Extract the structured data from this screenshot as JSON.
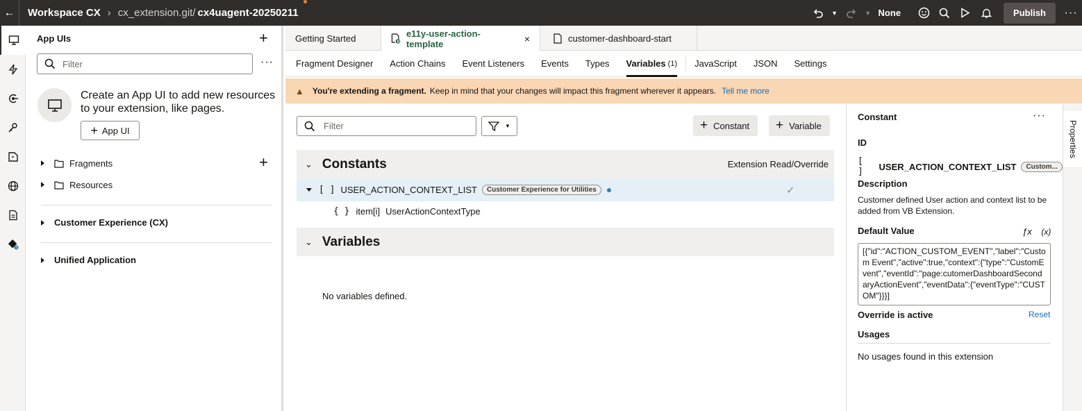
{
  "topbar": {
    "workspace": "Workspace CX",
    "repo": "cx_extension.git/",
    "branch": "cx4uagent-20250211",
    "level": "None",
    "publish_label": "Publish"
  },
  "panel": {
    "title": "App UIs",
    "filter_placeholder": "Filter",
    "create_text": "Create an App UI to add new resources to your extension, like pages.",
    "create_button": "App UI",
    "tree": [
      "Fragments",
      "Resources"
    ],
    "sections": [
      "Customer Experience (CX)",
      "Unified Application"
    ]
  },
  "tabs": [
    {
      "label": "Getting Started"
    },
    {
      "label": "e11y-user-action-template"
    },
    {
      "label": "customer-dashboard-start"
    }
  ],
  "subtabs": {
    "fragment_designer": "Fragment Designer",
    "action_chains": "Action Chains",
    "event_listeners": "Event Listeners",
    "events": "Events",
    "types": "Types",
    "variables": "Variables",
    "variables_count": "(1)",
    "javascript": "JavaScript",
    "json": "JSON",
    "settings": "Settings"
  },
  "banner": {
    "bold": "You're extending a fragment.",
    "text": "Keep in mind that your changes will impact this fragment wherever it appears.",
    "link": "Tell me more"
  },
  "content": {
    "filter_placeholder": "Filter",
    "constant_button": "Constant",
    "variable_button": "Variable",
    "constants_title": "Constants",
    "constants_right": "Extension Read/Override",
    "constant_name": "USER_ACTION_CONTEXT_LIST",
    "constant_badge": "Customer Experience for Utilities",
    "item_name": "item[i]",
    "item_type": "UserActionContextType",
    "variables_title": "Variables",
    "no_variables": "No variables defined."
  },
  "props": {
    "title": "Constant",
    "id_label": "ID",
    "id_value": "USER_ACTION_CONTEXT_LIST",
    "id_badge": "Custom...",
    "description_label": "Description",
    "description": "Customer defined User action and context list to be added from VB Extension.",
    "default_label": "Default Value",
    "fx": "ƒx",
    "x": "(x)",
    "default_value": "[{\"id\":\"ACTION_CUSTOM_EVENT\",\"label\":\"Custom Event\",\"active\":true,\"context\":{\"type\":\"CustomEvent\",\"eventId\":\"page:cutomerDashboardSecondaryActionEvent\",\"eventData\":{\"eventType\":\"CUSTOM\"}}}]",
    "override_label": "Override is active",
    "reset": "Reset",
    "usages_label": "Usages",
    "no_usages": "No usages found in this extension",
    "vertical_tab": "Properties"
  }
}
